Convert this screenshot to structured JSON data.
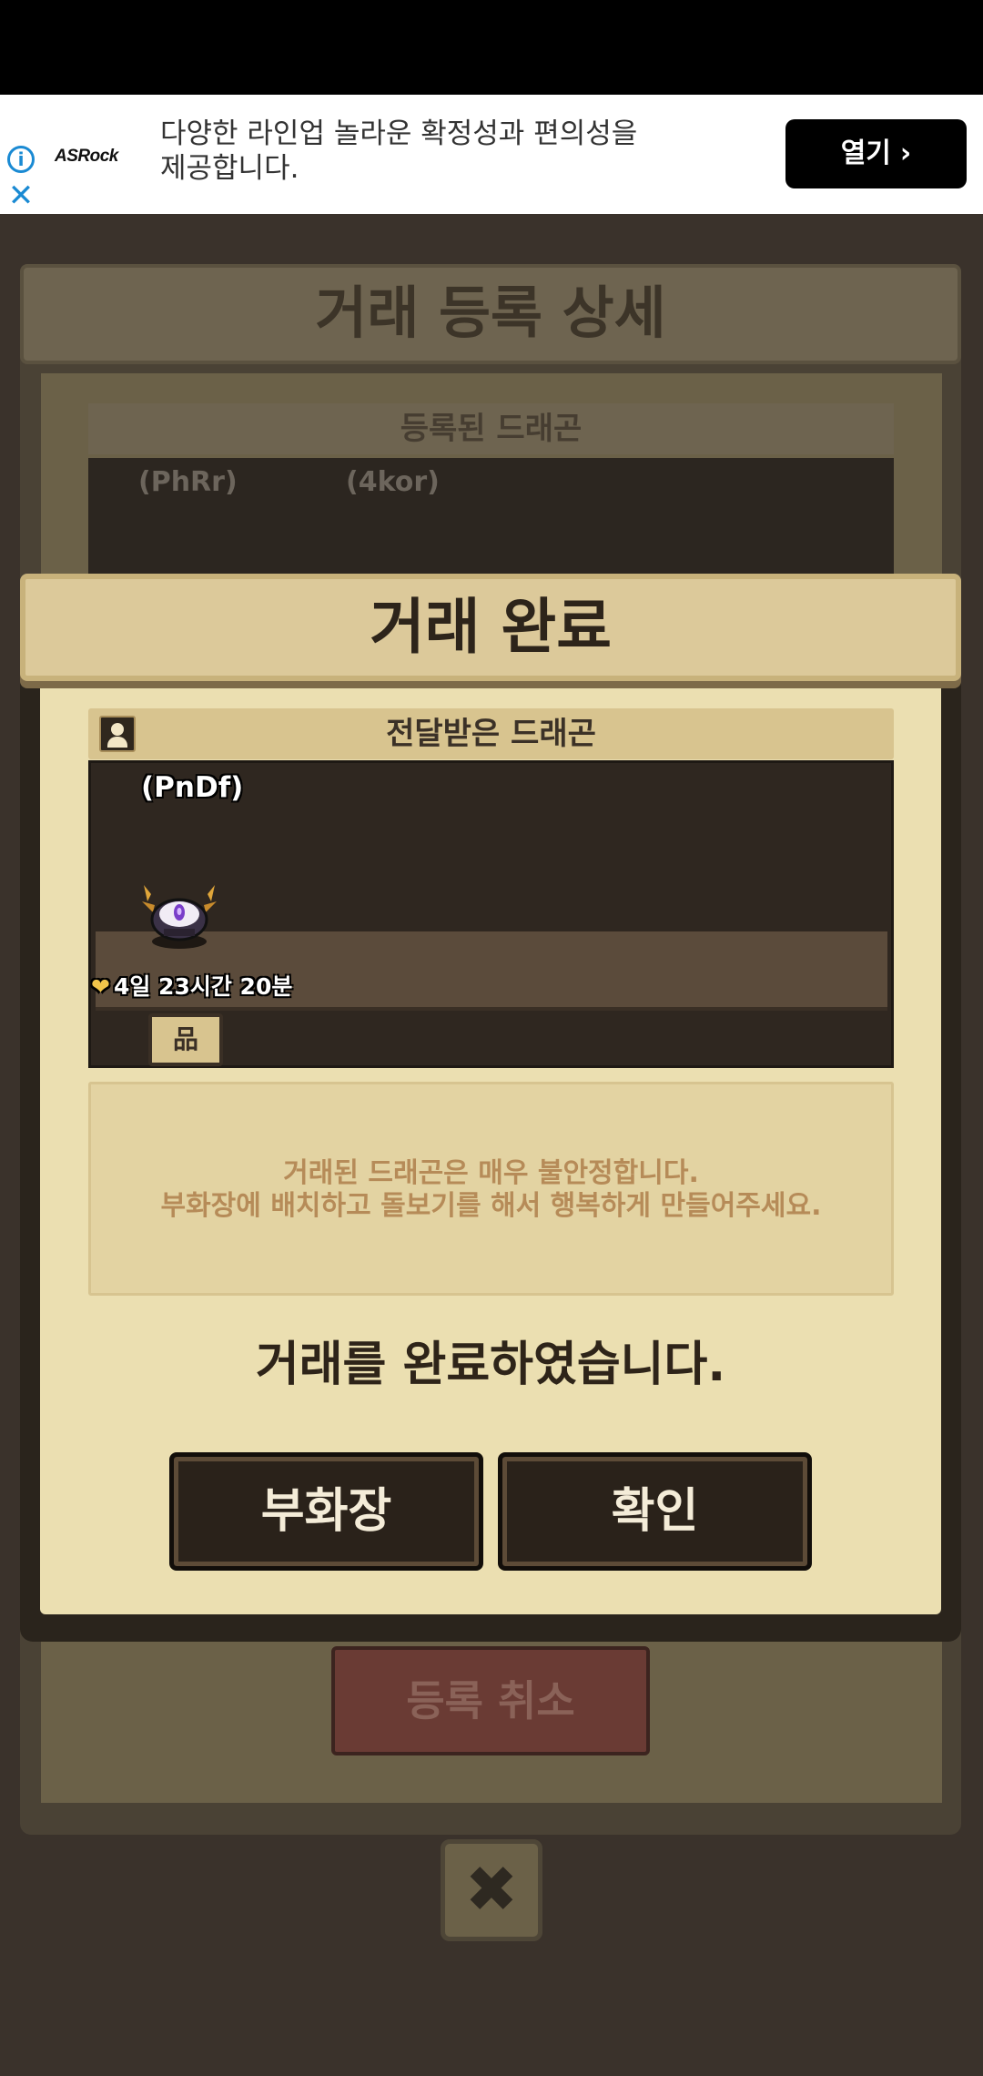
{
  "ad": {
    "brand": "ASRock",
    "text": "다양한 라인업 놀라운 확정성과 편의성을 제공합니다.",
    "open_label": "열기",
    "open_chevron": "›",
    "info_glyph": "i",
    "close_glyph": "✕"
  },
  "background": {
    "title": "거래 등록 상세",
    "subheader": "등록된 드래곤",
    "dragons": [
      "(PhRr)",
      "(4kor)"
    ],
    "cancel_label": "등록 취소",
    "close_glyph": "✖"
  },
  "modal": {
    "title": "거래 완료",
    "received_header": "전달받은 드래곤",
    "dragon_name": "(PnDf)",
    "timer": "4일 23시간 20분",
    "timer_icon": "heart-icon",
    "tree_glyph": "品",
    "notice_line1": "거래된 드래곤은 매우 불안정합니다.",
    "notice_line2": "부화장에 배치하고 돌보기를 해서 행복하게 만들어주세요.",
    "done_message": "거래를 완료하였습니다.",
    "storage_button": "부화장",
    "ok_button": "확인"
  }
}
